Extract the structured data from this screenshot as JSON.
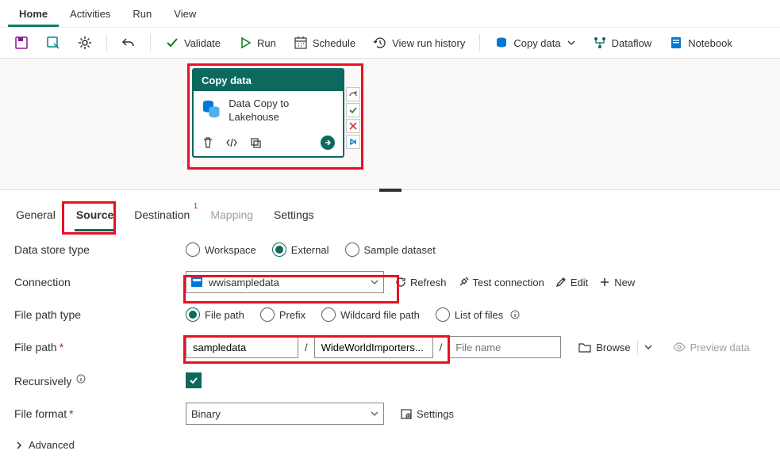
{
  "ribbon": {
    "tabs": [
      "Home",
      "Activities",
      "Run",
      "View"
    ],
    "active": 0
  },
  "toolbar": {
    "validate": "Validate",
    "run": "Run",
    "schedule": "Schedule",
    "view_run_history": "View run history",
    "copy_data": "Copy data",
    "dataflow": "Dataflow",
    "notebook": "Notebook"
  },
  "activity": {
    "head": "Copy data",
    "title": "Data Copy to Lakehouse"
  },
  "prop_tabs": {
    "general": "General",
    "source": "Source",
    "destination": "Destination",
    "mapping": "Mapping",
    "settings": "Settings"
  },
  "form": {
    "data_store_type_label": "Data store type",
    "dst_workspace": "Workspace",
    "dst_external": "External",
    "dst_sample": "Sample dataset",
    "connection_label": "Connection",
    "connection_value": "wwisampledata",
    "refresh": "Refresh",
    "test_connection": "Test connection",
    "edit": "Edit",
    "new": "New",
    "file_path_type_label": "File path type",
    "fpt_file_path": "File path",
    "fpt_prefix": "Prefix",
    "fpt_wildcard": "Wildcard file path",
    "fpt_list": "List of files",
    "file_path_label": "File path",
    "fp_container": "sampledata",
    "fp_directory": "WideWorldImporters...",
    "fp_file_placeholder": "File name",
    "browse": "Browse",
    "preview": "Preview data",
    "recursively_label": "Recursively",
    "file_format_label": "File format",
    "file_format_value": "Binary",
    "ff_settings": "Settings",
    "advanced": "Advanced"
  }
}
